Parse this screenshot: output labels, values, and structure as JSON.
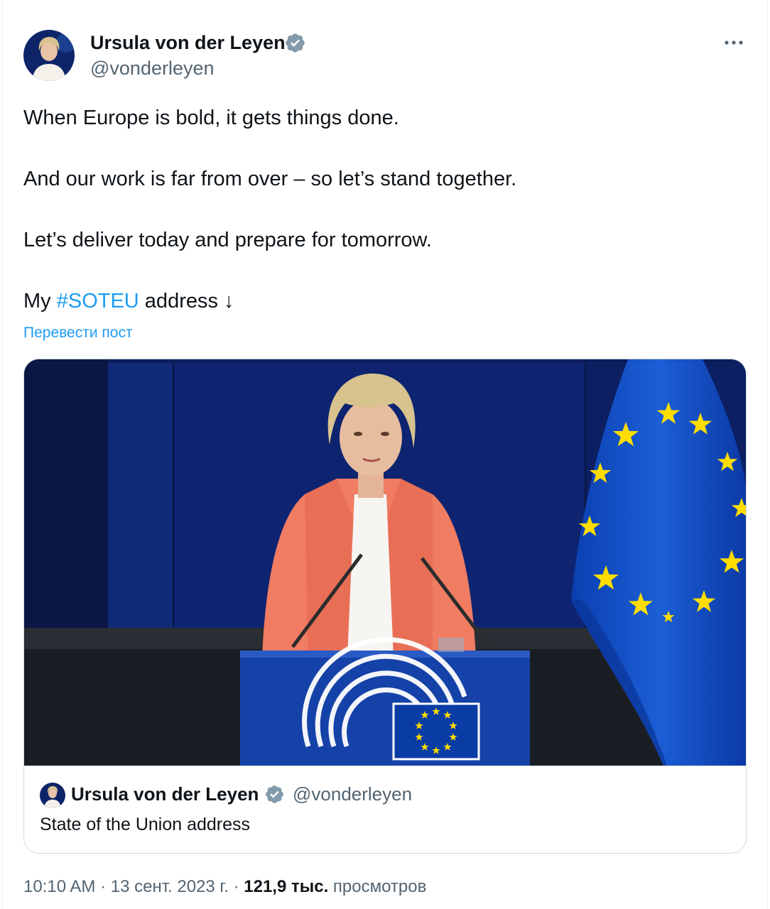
{
  "author": {
    "name": "Ursula von der Leyen",
    "handle": "@vonderleyen",
    "avatar_icon": "profile-photo",
    "verified_icon": "verified-badge-icon"
  },
  "tweet": {
    "lines": [
      "When Europe is bold, it gets things done.",
      "And our work is far from over – so let’s stand together.",
      "Let’s deliver today and prepare for tomorrow."
    ],
    "last_line_prefix": "My ",
    "hashtag": "#SOTEU",
    "last_line_suffix": " address ↓",
    "translate_label": "Перевести пост"
  },
  "card": {
    "author_name": "Ursula von der Leyen",
    "author_handle": "@vonderleyen",
    "title": "State of the Union address"
  },
  "meta": {
    "time": "10:10 AM",
    "separator": " · ",
    "date": "13 сент. 2023 г.",
    "views_count": "121,9 тыс.",
    "views_label": " просмотров"
  },
  "colors": {
    "link": "#1d9bf0",
    "secondary_text": "#536471",
    "border": "#cfd9de",
    "eu_blue": "#003399",
    "eu_yellow": "#ffcc00",
    "jacket": "#f07c62"
  }
}
